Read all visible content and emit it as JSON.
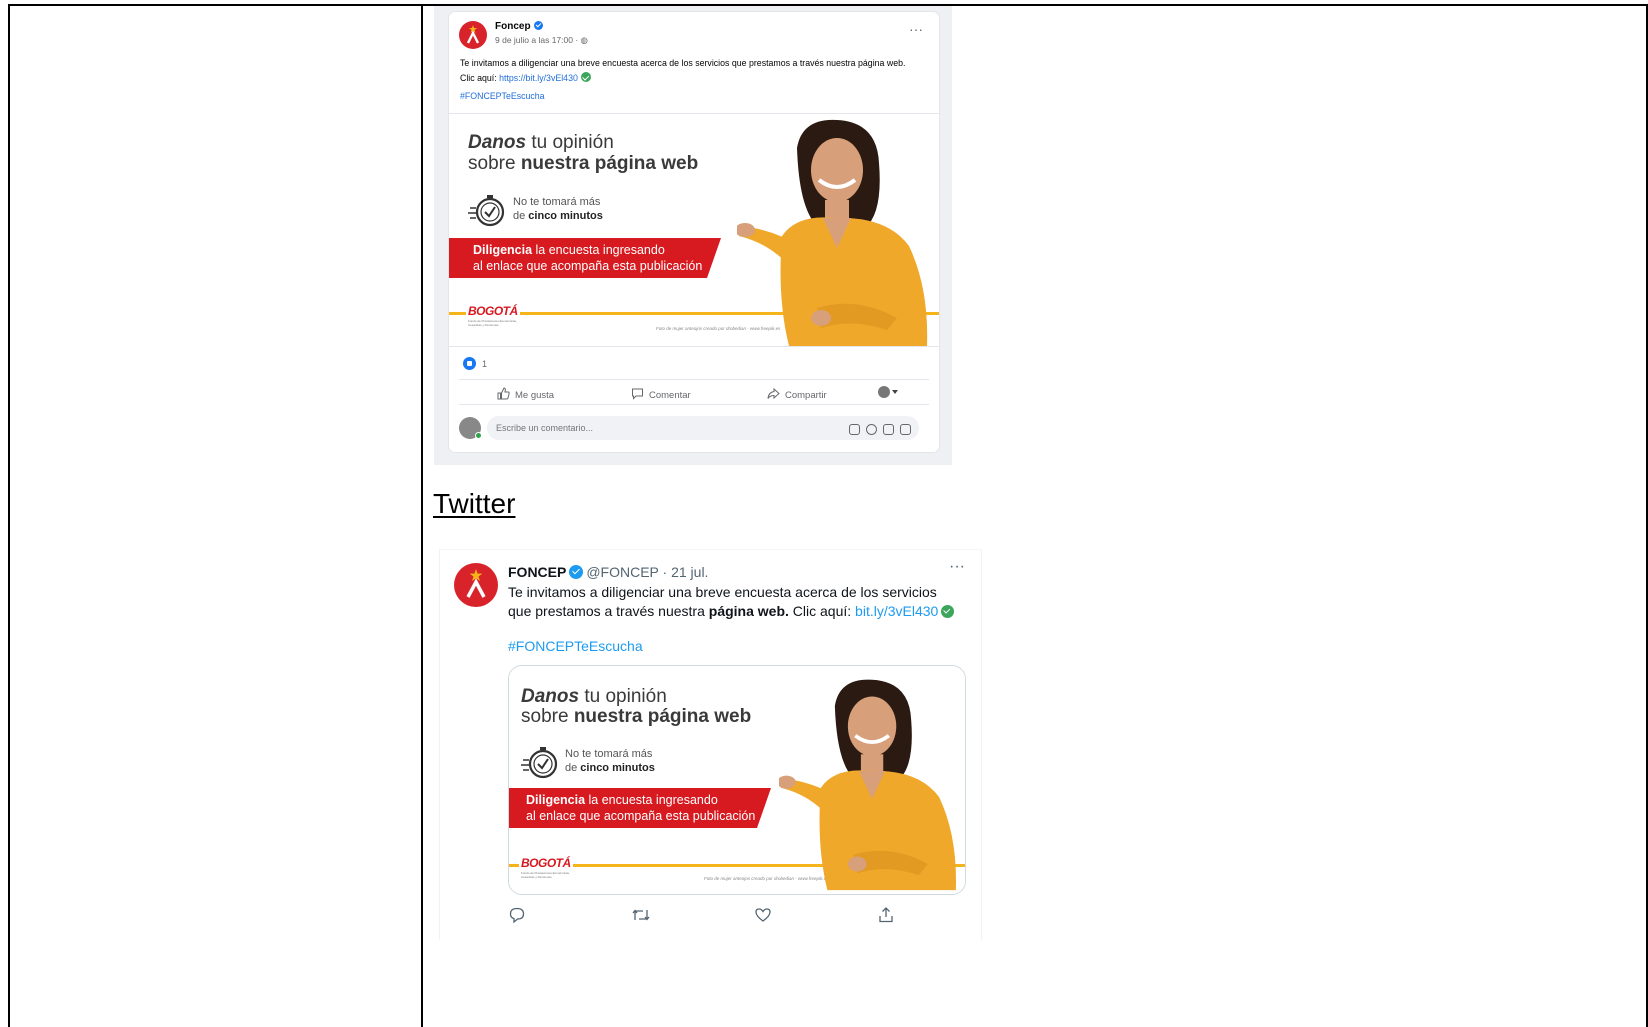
{
  "facebook": {
    "author": "Foncep",
    "date": "9 de julio a las 17:00 · ",
    "more": "···",
    "text_main": "Te invitamos a diligenciar una breve encuesta acerca de los servicios que prestamos a través nuestra página web. Clic aquí: ",
    "link": "https://bit.ly/3vEl430",
    "hashtag": "#FONCEPTeEscucha",
    "like_count": "1",
    "actions": {
      "like": "Me gusta",
      "comment": "Comentar",
      "share": "Compartir"
    },
    "comment_placeholder": "Escribe un comentario..."
  },
  "banner": {
    "head1_bold": "Danos",
    "head1_rest": " tu opinión",
    "head2_pre": "sobre ",
    "head2_bold": "nuestra página web",
    "time1": "No te tomará más",
    "time2_pre": "de ",
    "time2_bold": "cinco minutos",
    "red1_bold": "Diligencia",
    "red1_rest": " la encuesta ingresando",
    "red2": "al enlace que acompaña esta publicación",
    "logo": "BOGOTÁ",
    "logo_sub": "Fondo de Prestaciones Económicas, Cesantías y Pensiones",
    "credit": "Foto de mujer anteojos creado por drobedian - www.freepik.es"
  },
  "twitter": {
    "heading": "Twitter",
    "name": "FONCEP",
    "handle": "@FONCEP · 21 jul.",
    "more": "···",
    "text_pre": "Te invitamos a diligenciar una breve encuesta acerca de los servicios que prestamos a través nuestra ",
    "text_bold": "página web.",
    "text_mid": " Clic aquí: ",
    "link": "bit.ly/3vEl430",
    "hashtag": "#FONCEPTeEscucha"
  },
  "colors": {
    "brand_red": "#d71920",
    "banner_yellow": "#f4b41a",
    "fb_blue": "#1877f2",
    "tw_blue": "#1d9bf0"
  }
}
